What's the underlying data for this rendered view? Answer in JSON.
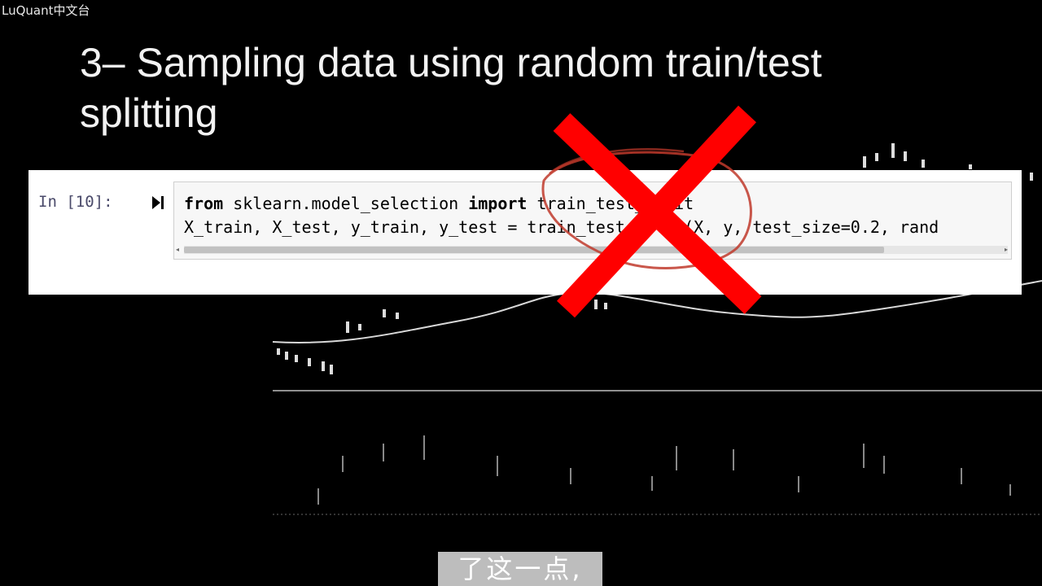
{
  "watermark": "LuQuant中文台",
  "slide": {
    "title_line1": "3– Sampling data using random train/test",
    "title_line2": "splitting"
  },
  "cell": {
    "prompt": "In [10]:",
    "code_line1_keyword": "from",
    "code_line1_module": " sklearn.model_selection ",
    "code_line1_import": "import",
    "code_line1_rest": " train_test_split",
    "code_line2": "X_train, X_test, y_train, y_test = train_test_split(X, y, test_size=0.2, rand"
  },
  "icons": {
    "run": "run-cell-icon",
    "cross": "red-cross-icon",
    "circle": "red-circle-annotation"
  },
  "colors": {
    "background": "#000000",
    "cross": "#ff0000",
    "annotation": "#c0392b"
  },
  "subtitle": "了这一点,"
}
